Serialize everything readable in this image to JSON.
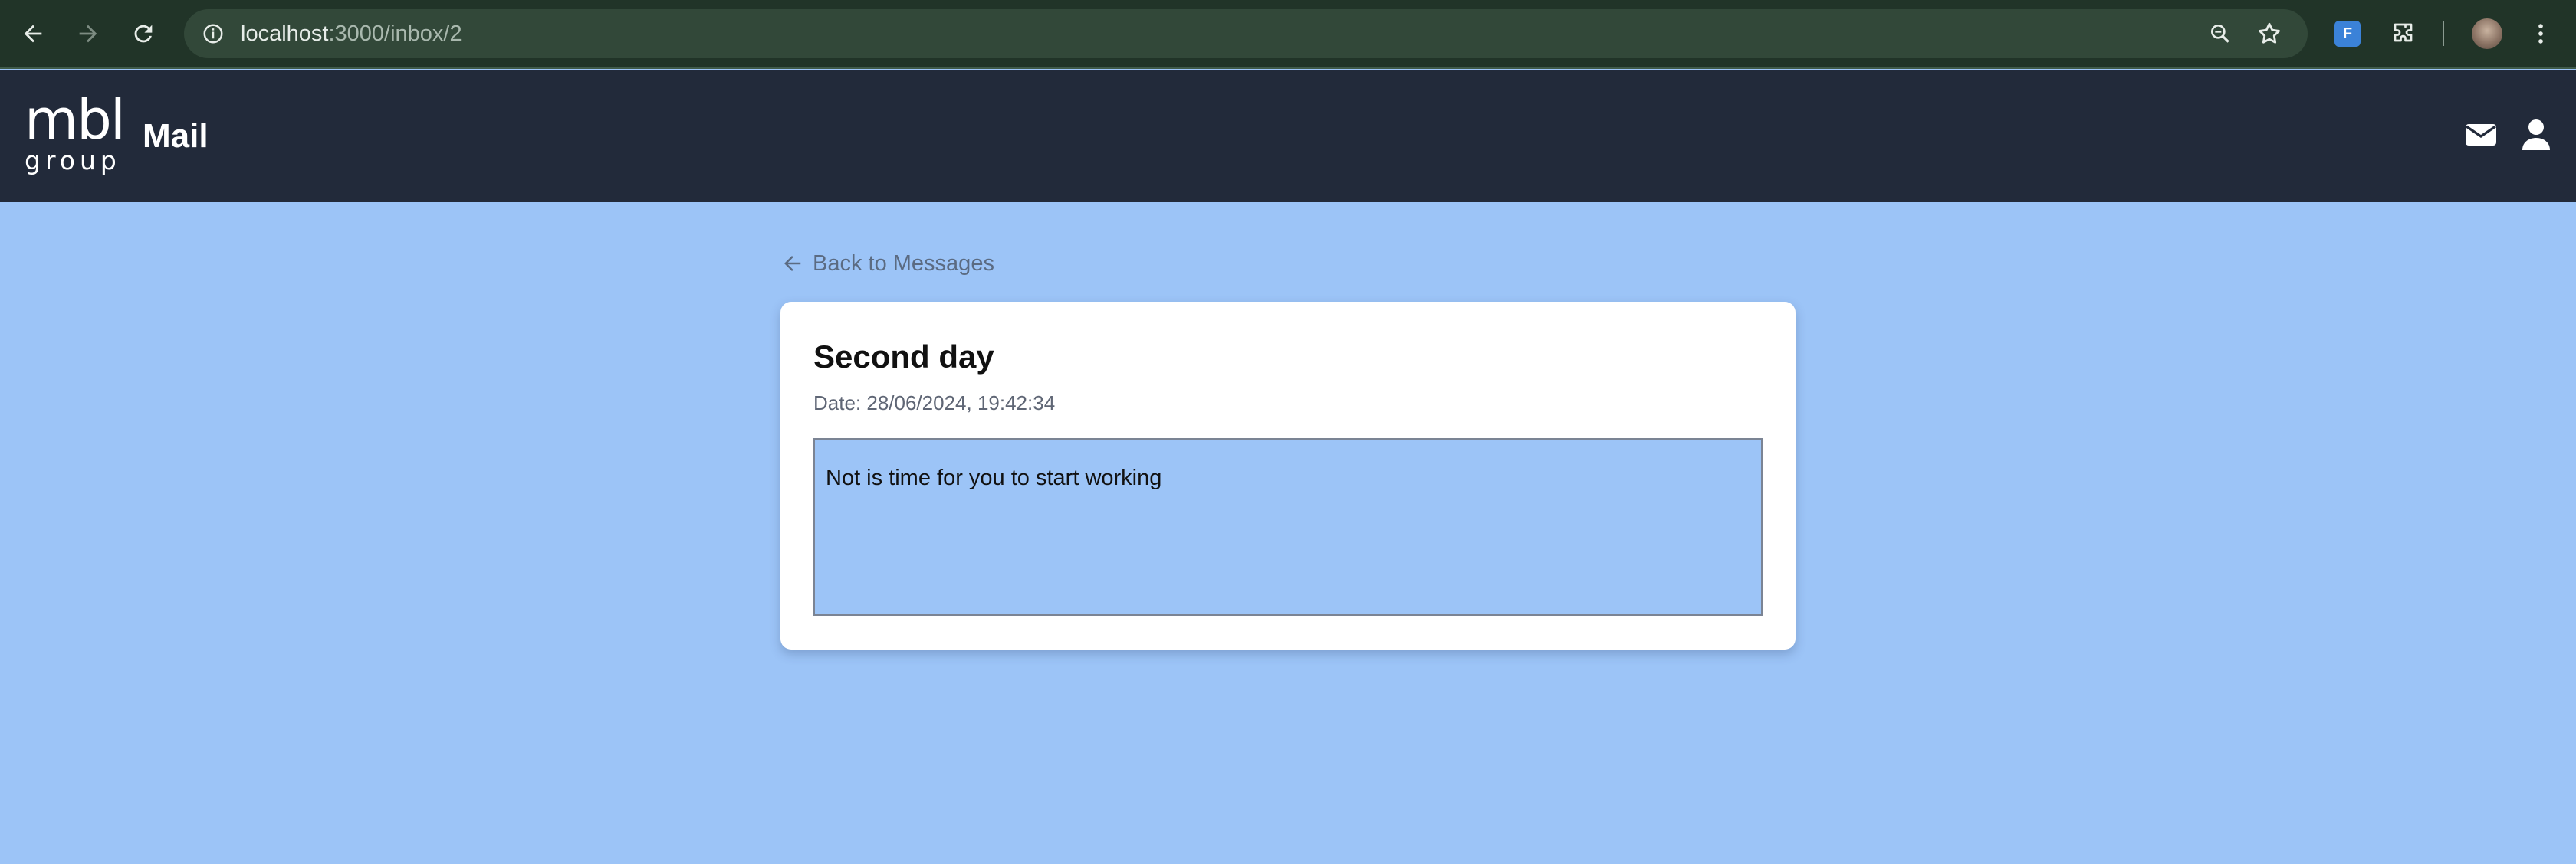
{
  "browser": {
    "url_host": "localhost",
    "url_path": ":3000/inbox/2",
    "translate_badge": "F"
  },
  "app": {
    "logo_mark": "mbl",
    "logo_sub": "group",
    "title": "Mail"
  },
  "content": {
    "back_label": "Back to Messages",
    "message": {
      "title": "Second day",
      "date": "Date: 28/06/2024, 19:42:34",
      "body": "Not is time for you to start working"
    }
  },
  "colors": {
    "page_background": "#9cc4f7",
    "header_background": "#222a3a",
    "browser_chrome": "#213428"
  },
  "icons": {
    "back": "arrow-left-icon",
    "forward": "arrow-right-icon",
    "reload": "reload-icon",
    "site_info": "info-icon",
    "zoom": "zoom-icon",
    "bookmark": "star-icon",
    "extensions": "puzzle-icon",
    "menu": "kebab-menu-icon",
    "mail": "envelope-icon",
    "user": "user-icon"
  }
}
